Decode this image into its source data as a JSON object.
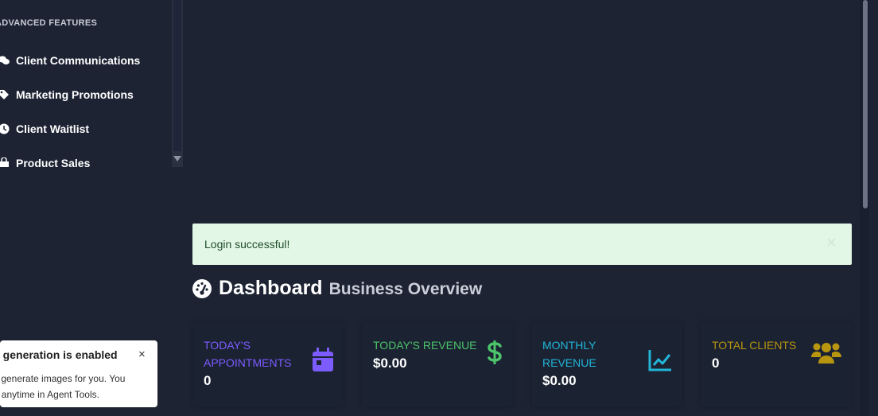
{
  "sidebar": {
    "section_title": "ADVANCED FEATURES",
    "items": [
      {
        "label": "Client Communications",
        "icon": "comments-icon"
      },
      {
        "label": "Marketing Promotions",
        "icon": "tags-icon"
      },
      {
        "label": "Client Waitlist",
        "icon": "clock-icon"
      },
      {
        "label": "Product Sales",
        "icon": "shopping-bag-icon"
      }
    ]
  },
  "alert": {
    "message": "Login successful!",
    "close_symbol": "×"
  },
  "header": {
    "title": "Dashboard",
    "subtitle": "Business Overview",
    "icon": "tachometer-icon"
  },
  "cards": [
    {
      "label": "TODAY'S APPOINTMENTS",
      "value": "0",
      "color": "#7c5cff",
      "icon": "calendar-icon"
    },
    {
      "label": "TODAY'S REVENUE",
      "value": "$0.00",
      "color": "#4cc46a",
      "icon": "dollar-icon"
    },
    {
      "label": "MONTHLY REVENUE",
      "value": "$0.00",
      "color": "#22b5d8",
      "icon": "chart-line-icon"
    },
    {
      "label": "TOTAL CLIENTS",
      "value": "0",
      "color": "#b8960f",
      "icon": "users-icon"
    }
  ],
  "notification": {
    "title": "e generation is enabled",
    "body_line1": "y generate images for you. You",
    "body_line2": "ff anytime in Agent Tools.",
    "close_symbol": "×"
  }
}
